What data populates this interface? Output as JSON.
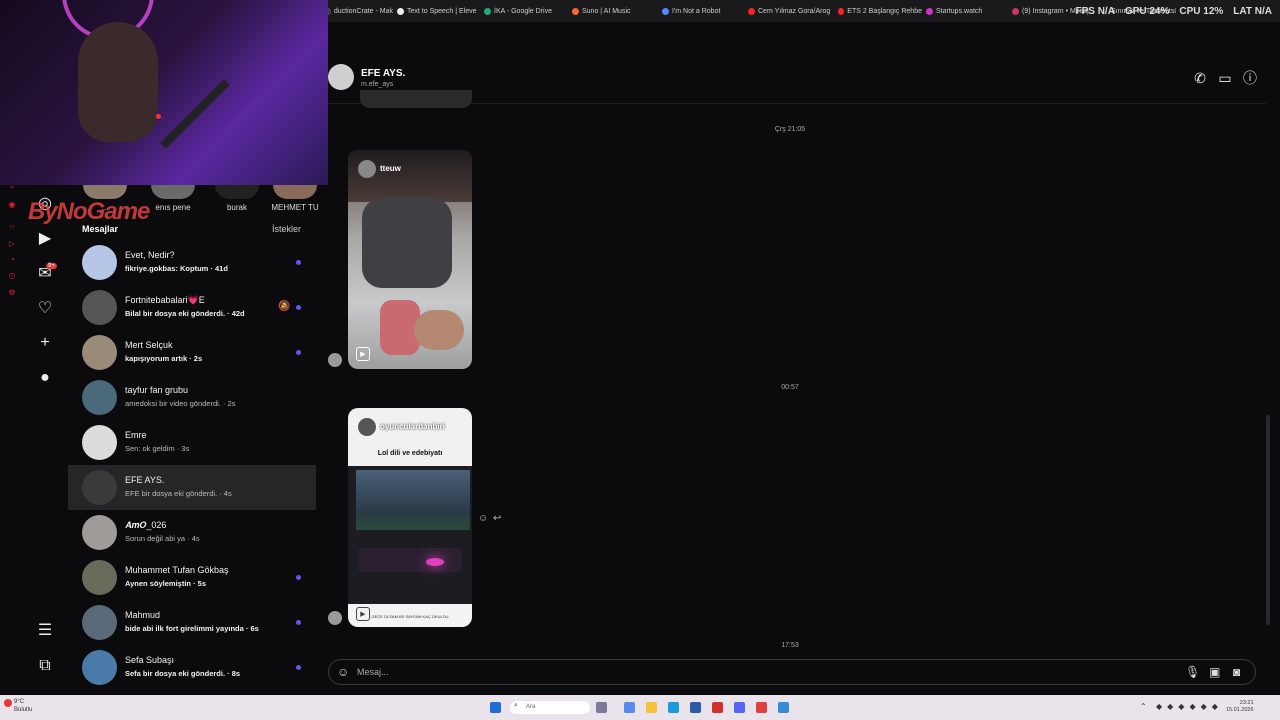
{
  "browser": {
    "tabs": [
      {
        "label": "ductionCrate - Mak",
        "color": "#444"
      },
      {
        "label": "Text to Speech | Eleve",
        "color": "#eee"
      },
      {
        "label": "İKA - Google Drive",
        "color": "#2a7"
      },
      {
        "label": "Suno | AI Music",
        "color": "#f63"
      },
      {
        "label": "I'm Not a Robot",
        "color": "#58f"
      },
      {
        "label": "Cem Yılmaz Gora/Arog",
        "color": "#f22"
      },
      {
        "label": "ETS 2 Başlangıç Rehbe",
        "color": "#f22"
      },
      {
        "label": "Startups.watch",
        "color": "#c3c"
      },
      {
        "label": "(9) Instagram • Mesaj",
        "color": "#c36"
      },
      {
        "label": "Sınırsız ve Taahhütsüz",
        "color": "#fff"
      }
    ],
    "hud": {
      "fps_label": "FPS",
      "fps_value": "N/A",
      "gpu_label": "GPU",
      "gpu_value": "24%",
      "cpu_label": "CPU",
      "cpu_value": "12%",
      "lat_label": "LAT",
      "lat_value": "N/A"
    }
  },
  "overlay": {
    "logo": "ByNoGame"
  },
  "rail": {
    "notif_badge": "9+"
  },
  "stories": [
    {
      "label": "...",
      "color": "#8a7a6a"
    },
    {
      "label": "enıs pene",
      "color": "#6a6a6a"
    },
    {
      "label": "burak",
      "color": "#222"
    },
    {
      "label": "MEHMET TU",
      "color": "#8a6a5a"
    }
  ],
  "list": {
    "title": "Mesajlar",
    "requests": "İstekler",
    "rows": [
      {
        "name": "Evet, Nedir?",
        "sub": "fikriye.gokbas: Koptum · 41d",
        "bold": true,
        "unread": true,
        "muted": false,
        "color": "#b6c6e6"
      },
      {
        "name": "Fortnitebabalari💗E",
        "sub": "Bilal bir dosya eki gönderdi. · 42d",
        "bold": true,
        "unread": true,
        "muted": true,
        "color": "#555"
      },
      {
        "name": "Mert Selçuk",
        "sub": "kapışıyorum artık · 2s",
        "bold": true,
        "unread": true,
        "muted": false,
        "color": "#9a8a78"
      },
      {
        "name": "tayfur fan grubu",
        "sub": "amedoksi bir video gönderdi. · 2s",
        "bold": false,
        "unread": false,
        "muted": false,
        "color": "#4a6a7a"
      },
      {
        "name": "Emre",
        "sub": "Sen: ok geldim · 3s",
        "bold": false,
        "unread": false,
        "muted": false,
        "color": "#dcdcdc"
      },
      {
        "name": "EFE AYS.",
        "sub": "EFE bir dosya eki gönderdi. · 4s",
        "bold": false,
        "unread": false,
        "muted": false,
        "color": "#3a3a3a"
      },
      {
        "name": "𝑨𝒎𝑶_026",
        "sub": "Sorun değil abi ya · 4s",
        "bold": false,
        "unread": false,
        "muted": false,
        "color": "#a09a98"
      },
      {
        "name": "Muhammet Tufan Gökbaş",
        "sub": "Aynen söylemiştin · 5s",
        "bold": true,
        "unread": true,
        "muted": false,
        "color": "#6a6a5a"
      },
      {
        "name": "Mahmud",
        "sub": "bide abi ilk fort girelimmi yayında · 6s",
        "bold": true,
        "unread": true,
        "muted": false,
        "color": "#5a6a7a"
      },
      {
        "name": "Sefa Subaşı",
        "sub": "Sefa bir dosya eki gönderdi. · 8s",
        "bold": true,
        "unread": true,
        "muted": false,
        "color": "#4a7aa8"
      }
    ]
  },
  "conversation": {
    "name": "EFE AYS.",
    "username": "m.efe_ays",
    "ts1": "Çrş 21:05",
    "ts2": "00:57",
    "ts3": "17:53",
    "reel1_user": "tteuw",
    "reel2_user": "oyunculardanbiri",
    "reel2_title": "Lol dili ve edebiyatı",
    "reel2_caption": "GECE OLSAM BE SAYFAM KAÇ OKULDU",
    "composer_placeholder": "Mesaj..."
  },
  "taskbar": {
    "weather_temp": "9°C",
    "weather_desc": "Bulutlu",
    "search_placeholder": "Ara",
    "time": "23:21",
    "date": "15.01.2026"
  }
}
